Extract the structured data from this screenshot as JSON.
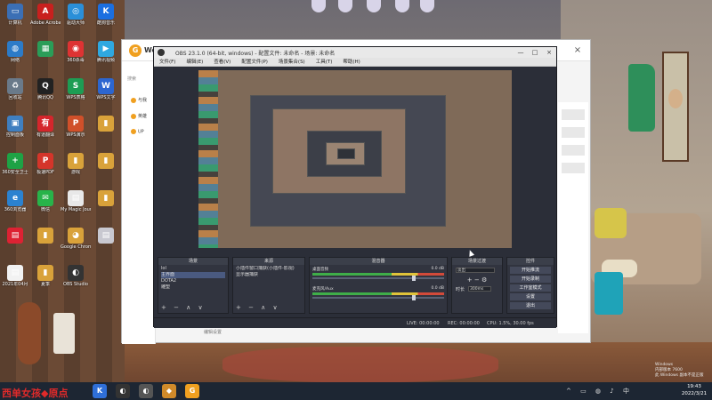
{
  "desktop": {
    "icons": [
      {
        "label": "计算机",
        "color": "#3b6fb5",
        "glyph": "▭"
      },
      {
        "label": "Adobe Acrobat DC",
        "color": "#c8201e",
        "glyph": "A"
      },
      {
        "label": "驱动大师",
        "color": "#2a8fd8",
        "glyph": "◎"
      },
      {
        "label": "酷狗音乐",
        "color": "#1b6fe0",
        "glyph": "K"
      },
      {
        "label": "网络",
        "color": "#2c7bc8",
        "glyph": "◍"
      },
      {
        "label": "",
        "color": "#2a9d58",
        "glyph": "▦"
      },
      {
        "label": "360杀毒",
        "color": "#d33",
        "glyph": "◉"
      },
      {
        "label": "腾讯视频",
        "color": "#2fa8e0",
        "glyph": "▶"
      },
      {
        "label": "回收站",
        "color": "#6a7a8a",
        "glyph": "♻"
      },
      {
        "label": "腾讯QQ",
        "color": "#222",
        "glyph": "Q"
      },
      {
        "label": "WPS表格",
        "color": "#1d9d54",
        "glyph": "S"
      },
      {
        "label": "WPS文字",
        "color": "#2c66d0",
        "glyph": "W"
      },
      {
        "label": "控制面板",
        "color": "#3f7fc0",
        "glyph": "▣"
      },
      {
        "label": "有道翻译",
        "color": "#d4262c",
        "glyph": "有"
      },
      {
        "label": "WPS演示",
        "color": "#d0502a",
        "glyph": "P"
      },
      {
        "label": "",
        "color": "#d9a23a",
        "glyph": "▮"
      },
      {
        "label": "360安全卫士",
        "color": "#1ea245",
        "glyph": "+"
      },
      {
        "label": "极速PDF",
        "color": "#d4352a",
        "glyph": "P"
      },
      {
        "label": "游戏",
        "color": "#d9a23a",
        "glyph": "▮"
      },
      {
        "label": "",
        "color": "#d9a23a",
        "glyph": "▮"
      },
      {
        "label": "360浏览器",
        "color": "#2b82d0",
        "glyph": "e"
      },
      {
        "label": "微信",
        "color": "#28b34a",
        "glyph": "✉"
      },
      {
        "label": "My Magic Journey.docx",
        "color": "#e8e8e8",
        "glyph": "▤"
      },
      {
        "label": "",
        "color": "#d9a23a",
        "glyph": "▮"
      },
      {
        "label": "",
        "color": "#d23",
        "glyph": "▤"
      },
      {
        "label": "",
        "color": "#d9a23a",
        "glyph": "▮"
      },
      {
        "label": "Google Chrome",
        "color": "#d9a23a",
        "glyph": "◕"
      },
      {
        "label": "",
        "color": "#c8c8d0",
        "glyph": "▤"
      },
      {
        "label": "2021年04月",
        "color": "#f2f2f2",
        "glyph": "▤"
      },
      {
        "label": "夏季",
        "color": "#d9a23a",
        "glyph": "▮"
      },
      {
        "label": "OBS Studio",
        "color": "#333",
        "glyph": "◐"
      }
    ]
  },
  "app": {
    "brand": "We",
    "logo": "G",
    "close": "×",
    "search": "搜索",
    "nav": [
      "与我",
      "英雄",
      "UP"
    ],
    "footer_link": "编辑设置"
  },
  "obs": {
    "title": "OBS 23.1.0 (64-bit, windows) - 配置文件: 未命名 - 场景: 未命名",
    "window_buttons": {
      "minimize": "—",
      "maximize": "□",
      "close": "×"
    },
    "menu": [
      "文件(F)",
      "编辑(E)",
      "查看(V)",
      "配置文件(P)",
      "场景集合(S)",
      "工具(T)",
      "帮助(H)"
    ],
    "scenes": {
      "title": "场景",
      "items": [
        "lol",
        "主界面",
        "DOTA2",
        "雕塑"
      ],
      "selected": 1
    },
    "sources": {
      "title": "来源",
      "items": [
        "小插件窗口捕获(小插件-影视)",
        "显示器捕获"
      ]
    },
    "mixer": {
      "title": "混音器",
      "tracks": [
        {
          "name": "桌面音频",
          "level": "0.0 dB"
        },
        {
          "name": "麦克风/Aux",
          "level": "0.0 dB"
        }
      ]
    },
    "transitions": {
      "title": "场景过渡",
      "type": "淡出",
      "duration_label": "时长",
      "duration": "300ms"
    },
    "controls": {
      "title": "控件",
      "buttons": [
        "开始推流",
        "开始录制",
        "工作室模式",
        "设置",
        "退出"
      ]
    },
    "status": {
      "live": "LIVE: 00:00:00",
      "rec": "REC: 00:00:00",
      "cpu": "CPU: 1.5%, 30.00 fps"
    },
    "dock_tools": "+ − ∧ ∨"
  },
  "taskbar": {
    "overlay_text": "西单女孩◆原点",
    "apps": [
      {
        "glyph": "K",
        "color": "#2f6fd8"
      },
      {
        "glyph": "◐",
        "color": "#333"
      },
      {
        "glyph": "◐",
        "color": "#555"
      },
      {
        "glyph": "◆",
        "color": "#d08a2a"
      },
      {
        "glyph": "G",
        "color": "#f0a020"
      }
    ],
    "tray": "^ ▭ ◍ ♪ 中",
    "clock_time": "19:43",
    "clock_date": "2022/3/21"
  },
  "watermark": [
    "Windows",
    "内部版本 7600",
    "此 Windows 副本不是正版"
  ]
}
